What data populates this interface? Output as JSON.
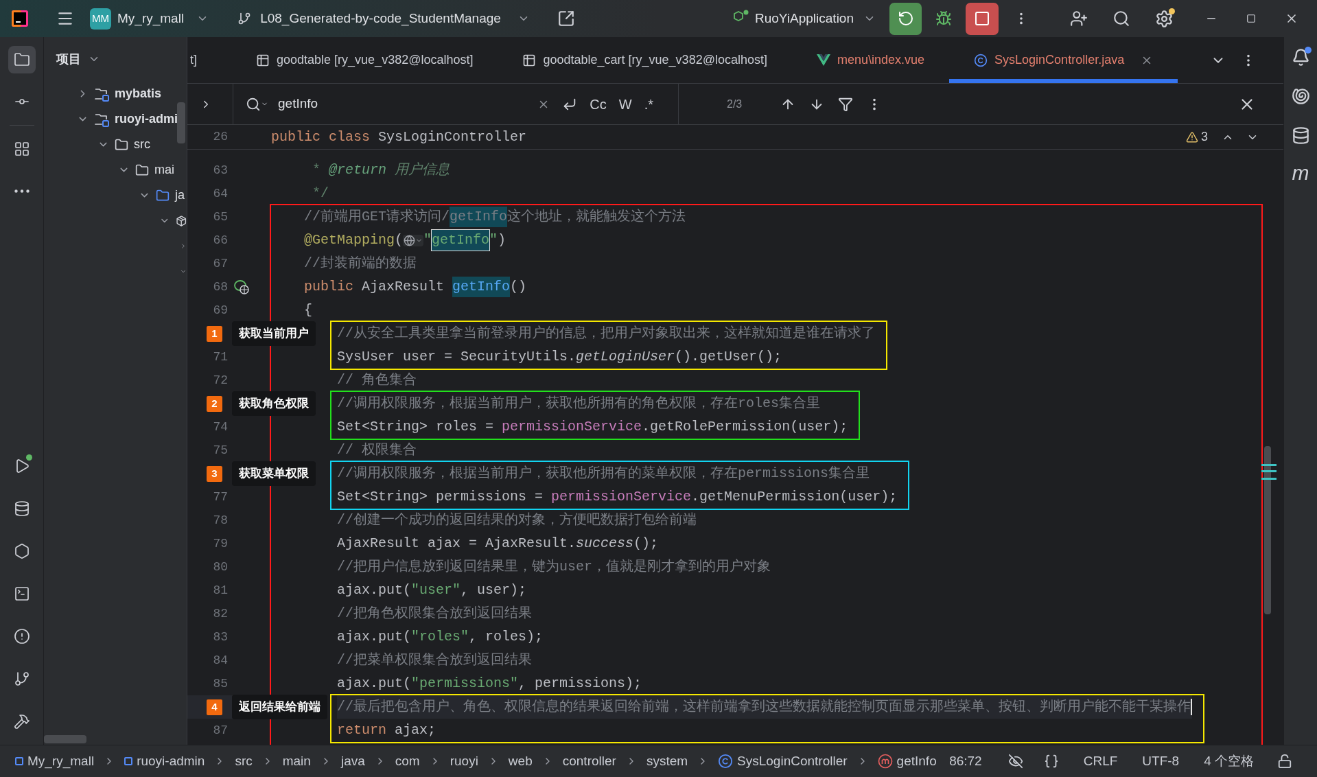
{
  "title_bar": {
    "project_badge": "MM",
    "project": "My_ry_mall",
    "branch": "L08_Generated-by-code_StudentManage",
    "run_config": "RuoYiApplication",
    "settings_has_update": true
  },
  "left_strip": {
    "top": [
      {
        "kind": "project",
        "selected": true
      },
      {
        "kind": "commit",
        "selected": false
      },
      {
        "kind": "structure",
        "selected": false
      },
      {
        "kind": "more",
        "selected": false
      }
    ],
    "bottom": [
      {
        "kind": "run",
        "has_badge": true
      },
      {
        "kind": "database",
        "has_badge": false
      },
      {
        "kind": "services",
        "has_badge": false
      },
      {
        "kind": "terminal",
        "has_badge": false
      },
      {
        "kind": "problems",
        "has_badge": false
      },
      {
        "kind": "git",
        "has_badge": false
      },
      {
        "kind": "build",
        "has_badge": false
      }
    ]
  },
  "project_panel": {
    "title": "项目",
    "tree": [
      {
        "label": "mybatis",
        "kind": "module",
        "expanded": false
      },
      {
        "label": "ruoyi-admi",
        "kind": "module",
        "expanded": true,
        "children": [
          {
            "label": "src",
            "kind": "folder",
            "expanded": true,
            "children": [
              {
                "label": "mai",
                "kind": "folder",
                "expanded": true,
                "children": [
                  {
                    "label": "ja",
                    "kind": "source",
                    "expanded": true,
                    "children": [
                      {
                        "kind": "package",
                        "expanded": true,
                        "children": [
                          {
                            "expanded": false
                          },
                          {
                            "expanded": true
                          }
                        ]
                      }
                    ]
                  }
                ]
              }
            ]
          }
        ]
      }
    ]
  },
  "tabs": [
    {
      "label": "t]",
      "kind": "partial",
      "selected": false,
      "has_errors": false
    },
    {
      "label": "goodtable [ry_vue_v382@localhost]",
      "kind": "table",
      "selected": false,
      "has_errors": false
    },
    {
      "label": "goodtable_cart [ry_vue_v382@localhost]",
      "kind": "table",
      "selected": false,
      "has_errors": false
    },
    {
      "label": "menu\\index.vue",
      "kind": "vue",
      "selected": false,
      "has_errors": true
    },
    {
      "label": "SysLoginController.java",
      "kind": "class",
      "selected": true,
      "has_errors": true
    }
  ],
  "search": {
    "value": "getInfo",
    "options": [
      "Cc",
      "W",
      ".*"
    ],
    "match_count": "2/3"
  },
  "editor": {
    "sticky_line": {
      "number": "26",
      "tokens": [
        {
          "kind": "keyword",
          "text": "public"
        },
        {
          "kind": "keyword",
          "text": " class"
        },
        {
          "kind": "plain",
          "text": " SysLoginController"
        }
      ]
    },
    "warning_count": "3",
    "rows": [
      {
        "kind": "line",
        "number": "63",
        "tokens": [
          {
            "kind": "doc",
            "text": "     * "
          },
          {
            "kind": "doc_tag",
            "text": "@return"
          },
          {
            "kind": "doc_italic",
            "text": " 用户信息"
          }
        ]
      },
      {
        "kind": "line",
        "number": "64",
        "tokens": [
          {
            "kind": "doc",
            "text": "     */"
          }
        ]
      },
      {
        "kind": "frame",
        "color": "#ff1a1a",
        "children": [
          {
            "kind": "line",
            "number": "65",
            "tokens": [
              {
                "kind": "comment",
                "text": "    //前端用GET请求访问/"
              },
              {
                "kind": "comment",
                "text": "getInfo",
                "highlighted": true
              },
              {
                "kind": "comment",
                "text": "这个地址，就能触发这个方法"
              }
            ]
          },
          {
            "kind": "line",
            "number": "66",
            "tokens": [
              {
                "kind": "annotation",
                "text": "    @GetMapping"
              },
              {
                "kind": "plain",
                "text": "("
              },
              {
                "kind": "globe"
              },
              {
                "kind": "string",
                "text": "\""
              },
              {
                "kind": "string",
                "text": "getInfo",
                "highlighted": true,
                "focused": true
              },
              {
                "kind": "string",
                "text": "\""
              },
              {
                "kind": "plain",
                "text": ")"
              }
            ]
          },
          {
            "kind": "line",
            "number": "67",
            "tokens": [
              {
                "kind": "comment",
                "text": "    //封装前端的数据"
              }
            ]
          },
          {
            "kind": "line",
            "number": "68",
            "endpoint_icon": true,
            "tokens": [
              {
                "kind": "keyword",
                "text": "    public"
              },
              {
                "kind": "plain",
                "text": " AjaxResult "
              },
              {
                "kind": "method_decl",
                "text": "getInfo",
                "highlighted": true
              },
              {
                "kind": "plain",
                "text": "()"
              }
            ]
          },
          {
            "kind": "line",
            "number": "69",
            "tokens": [
              {
                "kind": "plain",
                "text": "    {"
              }
            ]
          },
          {
            "kind": "frame",
            "color": "#f5e800",
            "children": [
              {
                "kind": "line",
                "callout": {
                  "number": "1",
                  "label": "获取当前用户"
                },
                "tokens": [
                  {
                    "kind": "comment",
                    "text": "        //从安全工具类里拿当前登录用户的信息，把用户对象取出来，这样就知道是谁在请求了"
                  }
                ]
              },
              {
                "kind": "line",
                "number": "71",
                "tokens": [
                  {
                    "kind": "plain",
                    "text": "        SysUser user = SecurityUtils."
                  },
                  {
                    "kind": "static",
                    "text": "getLoginUser"
                  },
                  {
                    "kind": "plain",
                    "text": "().getUser();"
                  }
                ]
              }
            ]
          },
          {
            "kind": "line",
            "number": "72",
            "tokens": [
              {
                "kind": "comment",
                "text": "        // 角色集合"
              }
            ]
          },
          {
            "kind": "frame",
            "color": "#22e01c",
            "children": [
              {
                "kind": "line",
                "callout": {
                  "number": "2",
                  "label": "获取角色权限"
                },
                "tokens": [
                  {
                    "kind": "comment",
                    "text": "        //调用权限服务，根据当前用户，获取他所拥有的角色权限，存在roles集合里"
                  }
                ]
              },
              {
                "kind": "line",
                "number": "74",
                "tokens": [
                  {
                    "kind": "plain",
                    "text": "        Set<String> roles = "
                  },
                  {
                    "kind": "field",
                    "text": "permissionService"
                  },
                  {
                    "kind": "plain",
                    "text": ".getRolePermission(user);"
                  }
                ]
              }
            ]
          },
          {
            "kind": "line",
            "number": "75",
            "tokens": [
              {
                "kind": "comment",
                "text": "        // 权限集合"
              }
            ]
          },
          {
            "kind": "frame",
            "color": "#12d4f0",
            "children": [
              {
                "kind": "line",
                "callout": {
                  "number": "3",
                  "label": "获取菜单权限"
                },
                "tokens": [
                  {
                    "kind": "comment",
                    "text": "        //调用权限服务，根据当前用户，获取他所拥有的菜单权限，存在permissions集合里"
                  }
                ]
              },
              {
                "kind": "line",
                "number": "77",
                "tokens": [
                  {
                    "kind": "plain",
                    "text": "        Set<String> permissions = "
                  },
                  {
                    "kind": "field",
                    "text": "permissionService"
                  },
                  {
                    "kind": "plain",
                    "text": ".getMenuPermission(user);"
                  }
                ]
              }
            ]
          },
          {
            "kind": "line",
            "number": "78",
            "tokens": [
              {
                "kind": "comment",
                "text": "        //创建一个成功的返回结果的对象，方便吧数据打包给前端"
              }
            ]
          },
          {
            "kind": "line",
            "number": "79",
            "tokens": [
              {
                "kind": "plain",
                "text": "        AjaxResult ajax = AjaxResult."
              },
              {
                "kind": "static",
                "text": "success"
              },
              {
                "kind": "plain",
                "text": "();"
              }
            ]
          },
          {
            "kind": "line",
            "number": "80",
            "tokens": [
              {
                "kind": "comment",
                "text": "        //把用户信息放到返回结果里，键为user，值就是刚才拿到的用户对象"
              }
            ]
          },
          {
            "kind": "line",
            "number": "81",
            "tokens": [
              {
                "kind": "plain",
                "text": "        ajax.put("
              },
              {
                "kind": "string",
                "text": "\"user\""
              },
              {
                "kind": "plain",
                "text": ", user);"
              }
            ]
          },
          {
            "kind": "line",
            "number": "82",
            "tokens": [
              {
                "kind": "comment",
                "text": "        //把角色权限集合放到返回结果"
              }
            ]
          },
          {
            "kind": "line",
            "number": "83",
            "tokens": [
              {
                "kind": "plain",
                "text": "        ajax.put("
              },
              {
                "kind": "string",
                "text": "\"roles\""
              },
              {
                "kind": "plain",
                "text": ", roles);"
              }
            ]
          },
          {
            "kind": "line",
            "number": "84",
            "tokens": [
              {
                "kind": "comment",
                "text": "        //把菜单权限集合放到返回结果"
              }
            ]
          },
          {
            "kind": "line",
            "number": "85",
            "tokens": [
              {
                "kind": "plain",
                "text": "        ajax.put("
              },
              {
                "kind": "string",
                "text": "\"permissions\""
              },
              {
                "kind": "plain",
                "text": ", permissions);"
              }
            ]
          },
          {
            "kind": "frame",
            "color": "#f5e800",
            "children": [
              {
                "kind": "line",
                "current": true,
                "callout": {
                  "number": "4",
                  "label": "返回结果给前端"
                },
                "tokens": [
                  {
                    "kind": "comment",
                    "text": "        //最后把包含用户、角色、权限信息的结果返回给前端，这样前端拿到这些数据就能控制页面显示那些菜单、按钮、判断用户能不能干某操作"
                  }
                ]
              },
              {
                "kind": "line",
                "number": "87",
                "tokens": [
                  {
                    "kind": "keyword",
                    "text": "        return"
                  },
                  {
                    "kind": "plain",
                    "text": " ajax;"
                  }
                ]
              }
            ]
          }
        ]
      }
    ]
  },
  "right_strip": {
    "notifications_badge": true,
    "maven_label": "m"
  },
  "status_bar": {
    "breadcrumbs": [
      {
        "label": "My_ry_mall",
        "kind": "module"
      },
      {
        "label": "ruoyi-admin",
        "kind": "module"
      },
      {
        "label": "src",
        "kind": "folder"
      },
      {
        "label": "main",
        "kind": "folder"
      },
      {
        "label": "java",
        "kind": "folder"
      },
      {
        "label": "com",
        "kind": "folder"
      },
      {
        "label": "ruoyi",
        "kind": "folder"
      },
      {
        "label": "web",
        "kind": "folder"
      },
      {
        "label": "controller",
        "kind": "folder"
      },
      {
        "label": "system",
        "kind": "folder"
      },
      {
        "label": "SysLoginController",
        "kind": "class"
      },
      {
        "label": "getInfo",
        "kind": "method"
      }
    ],
    "position": "86:72",
    "line_ending": "CRLF",
    "encoding": "UTF-8",
    "indent": "4 个空格"
  }
}
